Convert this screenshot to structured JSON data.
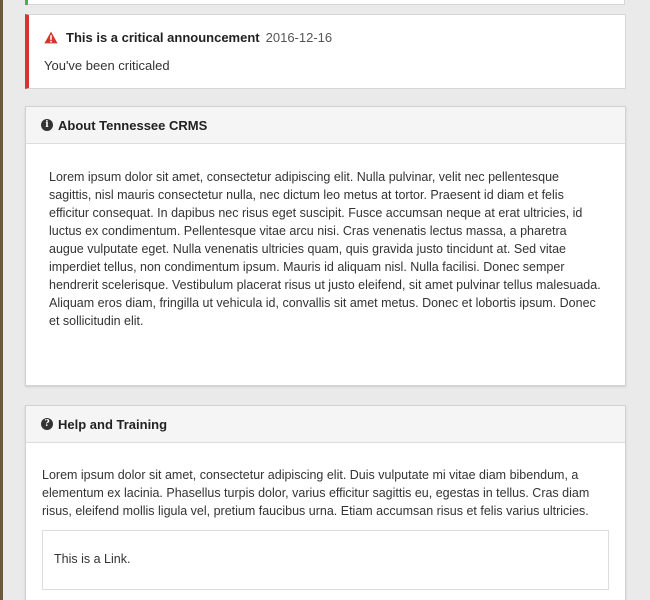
{
  "announcement": {
    "title": "This is a critical announcement",
    "date": "2016-12-16",
    "message": "You've been criticaled",
    "accent_color": "#d9342b",
    "icon": "warning-triangle-icon"
  },
  "about_panel": {
    "title": "About Tennessee CRMS",
    "icon": "info-circle-icon",
    "body": "Lorem ipsum dolor sit amet, consectetur adipiscing elit. Nulla pulvinar, velit nec pellentesque sagittis, nisl mauris consectetur nulla, nec dictum leo metus at tortor. Praesent id diam et felis efficitur consequat. In dapibus nec risus eget suscipit. Fusce accumsan neque at erat ultricies, id luctus ex condimentum. Pellentesque vitae arcu nisi. Cras venenatis lectus massa, a pharetra augue vulputate eget. Nulla venenatis ultricies quam, quis gravida justo tincidunt at. Sed vitae imperdiet tellus, non condimentum ipsum. Mauris id aliquam nisl. Nulla facilisi. Donec semper hendrerit scelerisque. Vestibulum placerat risus ut justo eleifend, sit amet pulvinar tellus malesuada. Aliquam eros diam, fringilla ut vehicula id, convallis sit amet metus. Donec et lobortis ipsum. Donec et sollicitudin elit."
  },
  "help_panel": {
    "title": "Help and Training",
    "icon": "question-circle-icon",
    "body": "Lorem ipsum dolor sit amet, consectetur adipiscing elit. Duis vulputate mi vitae diam bibendum, a elementum ex lacinia. Phasellus turpis dolor, varius efficitur sagittis eu, egestas in tellus. Cras diam risus, eleifend mollis ligula vel, pretium faucibus urna. Etiam accumsan risus et felis varius ultricies.",
    "link_text": "This is a Link."
  }
}
